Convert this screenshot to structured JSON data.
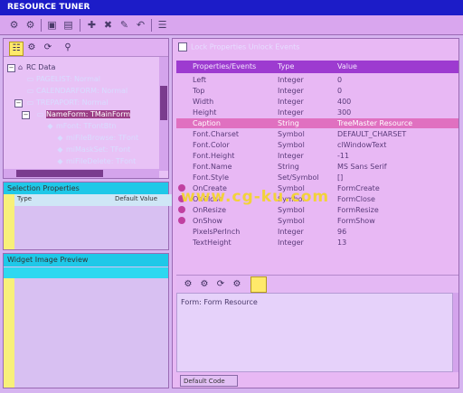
{
  "window": {
    "title": "RESOURCE TUNER"
  },
  "toolbar": {
    "icons": [
      "gear-icon",
      "gear-icon",
      "save-icon",
      "open-icon",
      "add-icon",
      "delete-icon",
      "tool-icon",
      "undo-icon",
      "list-icon"
    ]
  },
  "tree": {
    "nodes": [
      {
        "label": "RC Data",
        "level": 0,
        "icon": "folder-icon"
      },
      {
        "label": "PAGELIST: Normal",
        "level": 1,
        "icon": "form-icon"
      },
      {
        "label": "CALENDARFORM: Normal",
        "level": 1,
        "icon": "form-icon"
      },
      {
        "label": "TREPAPORT: Normal",
        "level": 1,
        "icon": "form-icon"
      },
      {
        "label": "NameForm: TMainForm",
        "level": 2,
        "icon": "form-icon",
        "selected": true
      },
      {
        "label": "mFont: TFontBtn",
        "level": 3,
        "icon": "component-icon"
      },
      {
        "label": "miFileBrowse: TFont",
        "level": 4,
        "icon": "component-icon"
      },
      {
        "label": "miMaskSet: TFont",
        "level": 4,
        "icon": "component-icon"
      },
      {
        "label": "miFileDelete: TFont",
        "level": 4,
        "icon": "component-icon"
      }
    ]
  },
  "selection_panel": {
    "title": "Selection Properties",
    "col1": "Type",
    "col2": "Default Value"
  },
  "image_panel": {
    "title": "Widget Image Preview"
  },
  "properties": {
    "checkbox_label": "Lock Properties Unlock Events",
    "columns": [
      "Properties/Events",
      "Type",
      "Value"
    ],
    "rows": [
      {
        "name": "Left",
        "type": "Integer",
        "value": "0",
        "event": false
      },
      {
        "name": "Top",
        "type": "Integer",
        "value": "0",
        "event": false
      },
      {
        "name": "Width",
        "type": "Integer",
        "value": "400",
        "event": false
      },
      {
        "name": "Height",
        "type": "Integer",
        "value": "300",
        "event": false
      },
      {
        "name": "Caption",
        "type": "String",
        "value": "TreeMaster Resource",
        "event": false,
        "selected": true
      },
      {
        "name": "Font.Charset",
        "type": "Symbol",
        "value": "DEFAULT_CHARSET",
        "event": false
      },
      {
        "name": "Font.Color",
        "type": "Symbol",
        "value": "clWindowText",
        "event": false
      },
      {
        "name": "Font.Height",
        "type": "Integer",
        "value": "-11",
        "event": false
      },
      {
        "name": "Font.Name",
        "type": "String",
        "value": "MS Sans Serif",
        "event": false
      },
      {
        "name": "Font.Style",
        "type": "Set/Symbol",
        "value": "[]",
        "event": false
      },
      {
        "name": "OnCreate",
        "type": "Symbol",
        "value": "FormCreate",
        "event": true
      },
      {
        "name": "OnClose",
        "type": "Symbol",
        "value": "FormClose",
        "event": true
      },
      {
        "name": "OnResize",
        "type": "Symbol",
        "value": "FormResize",
        "event": true
      },
      {
        "name": "OnShow",
        "type": "Symbol",
        "value": "FormShow",
        "event": true
      },
      {
        "name": "PixelsPerInch",
        "type": "Integer",
        "value": "96",
        "event": false
      },
      {
        "name": "TextHeight",
        "type": "Integer",
        "value": "13",
        "event": false
      }
    ]
  },
  "editor": {
    "text": "Form: Form Resource",
    "default_button": "Default Code"
  },
  "watermark": "www.cg-ku.com"
}
